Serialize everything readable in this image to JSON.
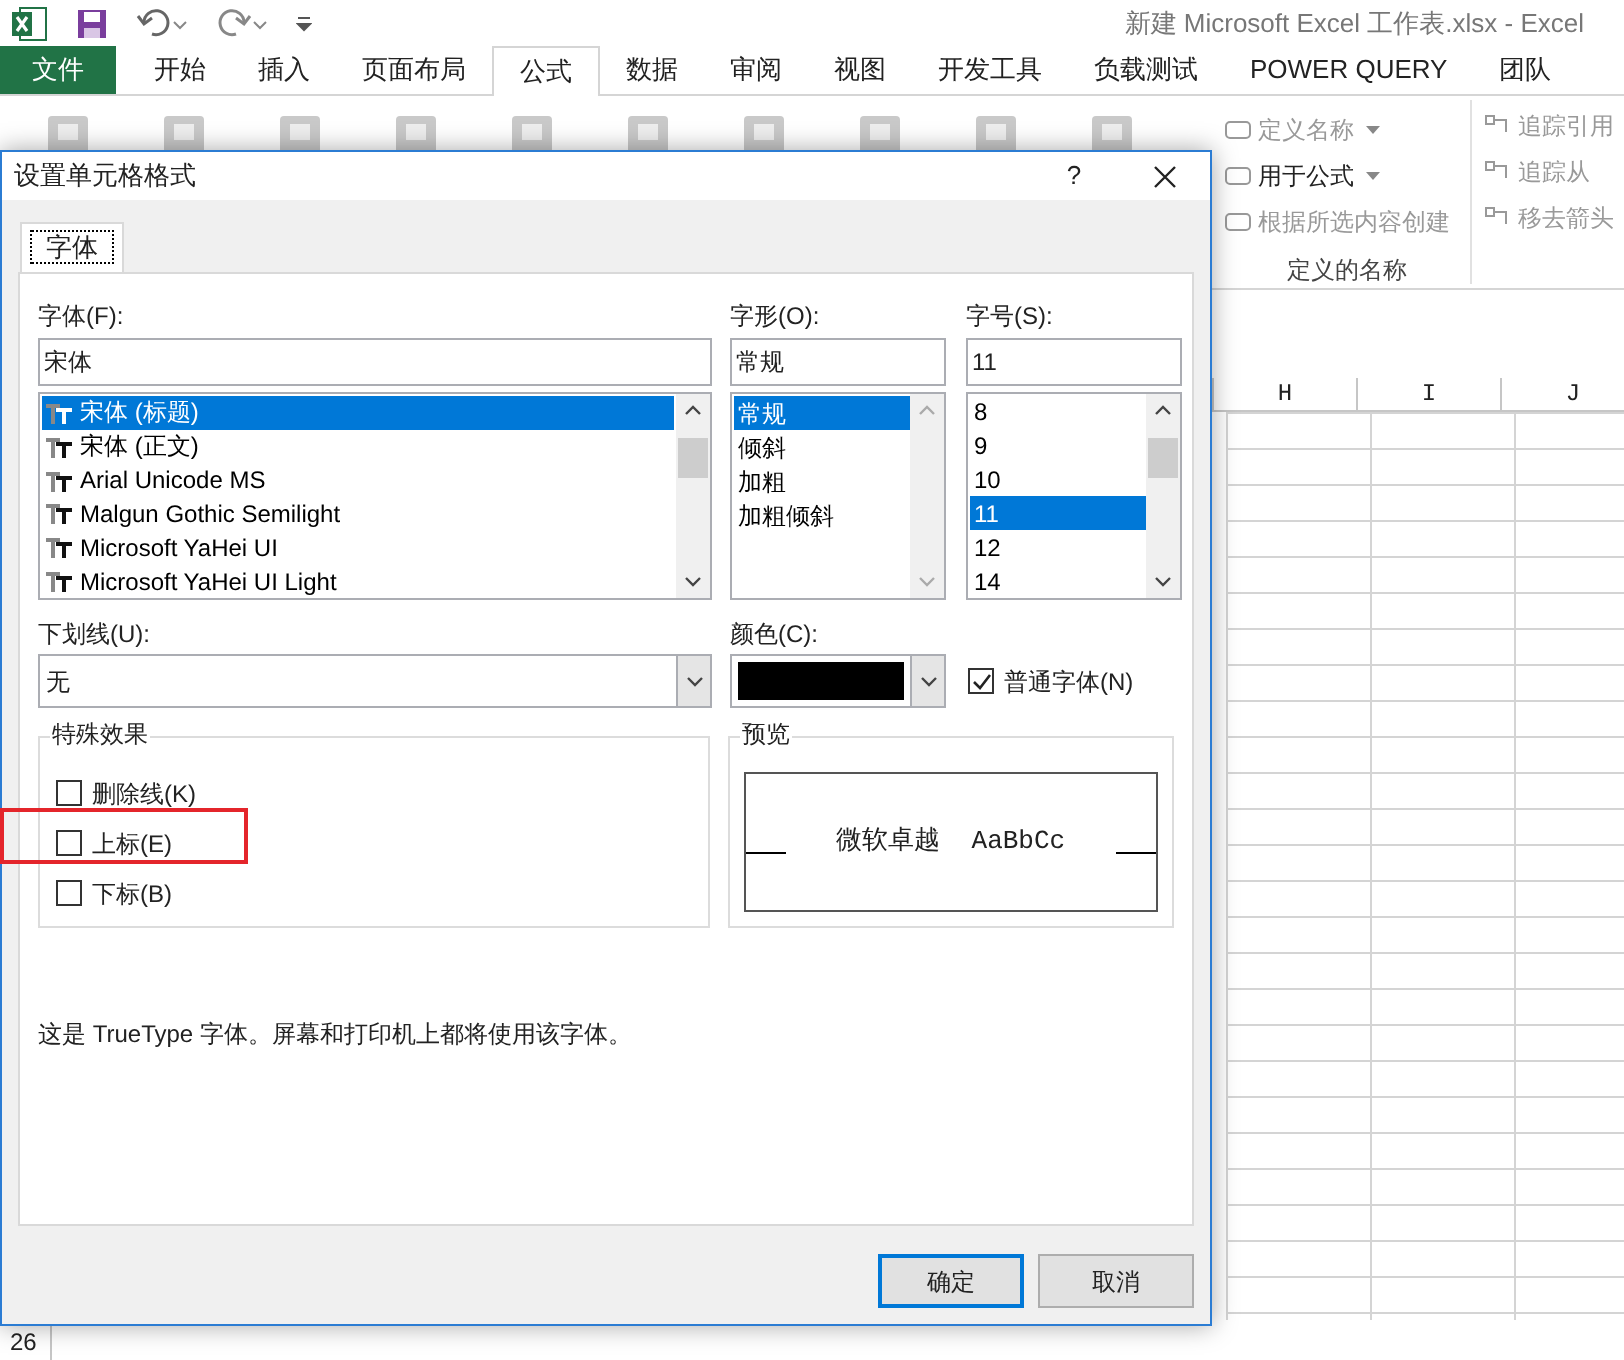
{
  "app": {
    "title": "新建 Microsoft Excel 工作表.xlsx - Excel"
  },
  "ribbon_tabs": [
    {
      "label": "文件",
      "kind": "file",
      "selected": false
    },
    {
      "label": "开始",
      "kind": "tab",
      "selected": false
    },
    {
      "label": "插入",
      "kind": "tab",
      "selected": false
    },
    {
      "label": "页面布局",
      "kind": "tab",
      "selected": false
    },
    {
      "label": "公式",
      "kind": "tab",
      "selected": true
    },
    {
      "label": "数据",
      "kind": "tab",
      "selected": false
    },
    {
      "label": "审阅",
      "kind": "tab",
      "selected": false
    },
    {
      "label": "视图",
      "kind": "tab",
      "selected": false
    },
    {
      "label": "开发工具",
      "kind": "tab",
      "selected": false
    },
    {
      "label": "负载测试",
      "kind": "tab",
      "selected": false
    },
    {
      "label": "POWER QUERY",
      "kind": "tab",
      "selected": false
    },
    {
      "label": "团队",
      "kind": "tab",
      "selected": false
    }
  ],
  "names_group": {
    "title": "定义的名称",
    "items": [
      {
        "label": "定义名称",
        "dropdown": true,
        "disabled": true
      },
      {
        "label": "用于公式",
        "dropdown": true,
        "disabled": false
      },
      {
        "label": "根据所选内容创建",
        "dropdown": false,
        "disabled": true
      }
    ]
  },
  "audit_group": {
    "items": [
      {
        "label": "追踪引用",
        "disabled": true
      },
      {
        "label": "追踪从",
        "disabled": true
      },
      {
        "label": "移去箭头",
        "disabled": true
      }
    ]
  },
  "sheet": {
    "columns": [
      "H",
      "I",
      "J"
    ],
    "row_header": "26"
  },
  "dialog": {
    "title": "设置单元格格式",
    "help": "?",
    "tabs": [
      {
        "label": "字体",
        "selected": true
      }
    ],
    "font": {
      "label": "字体(F):",
      "value": "宋体",
      "items": [
        {
          "label": "宋体 (标题)",
          "selected": true
        },
        {
          "label": "宋体 (正文)",
          "selected": false
        },
        {
          "label": "Arial Unicode MS",
          "selected": false
        },
        {
          "label": "Malgun Gothic Semilight",
          "selected": false
        },
        {
          "label": "Microsoft YaHei UI",
          "selected": false
        },
        {
          "label": "Microsoft YaHei UI Light",
          "selected": false
        }
      ]
    },
    "style": {
      "label": "字形(O):",
      "value": "常规",
      "items": [
        {
          "label": "常规",
          "selected": true
        },
        {
          "label": "倾斜",
          "selected": false
        },
        {
          "label": "加粗",
          "selected": false
        },
        {
          "label": "加粗倾斜",
          "selected": false
        }
      ]
    },
    "size": {
      "label": "字号(S):",
      "value": "11",
      "items": [
        {
          "label": "8",
          "selected": false
        },
        {
          "label": "9",
          "selected": false
        },
        {
          "label": "10",
          "selected": false
        },
        {
          "label": "11",
          "selected": true
        },
        {
          "label": "12",
          "selected": false
        },
        {
          "label": "14",
          "selected": false
        }
      ]
    },
    "underline": {
      "label": "下划线(U):",
      "value": "无"
    },
    "color": {
      "label": "颜色(C):"
    },
    "normal_font": {
      "label": "普通字体(N)",
      "checked": true
    },
    "effects": {
      "title": "特殊效果",
      "items": [
        {
          "label": "删除线(K)",
          "checked": false,
          "highlighted": false
        },
        {
          "label": "上标(E)",
          "checked": false,
          "highlighted": true
        },
        {
          "label": "下标(B)",
          "checked": false,
          "highlighted": false
        }
      ]
    },
    "preview": {
      "title": "预览",
      "text": "微软卓越  AaBbCc"
    },
    "description": "这是 TrueType 字体。屏幕和打印机上都将使用该字体。",
    "buttons": [
      {
        "label": "确定",
        "default": true
      },
      {
        "label": "取消",
        "default": false
      }
    ]
  }
}
